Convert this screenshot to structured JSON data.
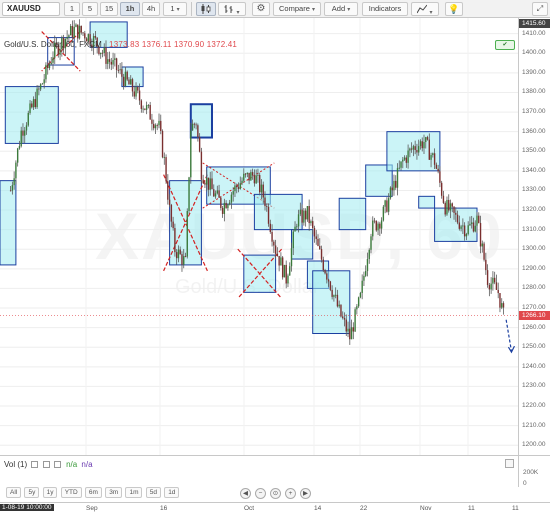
{
  "toolbar": {
    "symbol": "XAUUSD",
    "intervals": [
      "1",
      "5",
      "15",
      "1h",
      "4h",
      "1"
    ],
    "active_interval": "1h",
    "compare_label": "Compare",
    "add_label": "Add",
    "indicators_label": "Indicators"
  },
  "legend": {
    "title": "Gold/U.S. Dollar, 60, FXCM",
    "ohlc": [
      "1373.83",
      "1376.11",
      "1370.90",
      "1372.41"
    ]
  },
  "watermark": {
    "symbol": "XAUUSD, 60",
    "description": "Gold/U.S. Dollar"
  },
  "price_axis": {
    "ticks": [
      "1410.00",
      "1400.00",
      "1390.00",
      "1380.00",
      "1370.00",
      "1360.00",
      "1350.00",
      "1340.00",
      "1330.00",
      "1320.00",
      "1310.00",
      "1300.00",
      "1290.00",
      "1280.00",
      "1270.00",
      "1260.00",
      "1250.00",
      "1240.00",
      "1230.00",
      "1220.00",
      "1210.00",
      "1200.00"
    ],
    "top_badge": "1415.60",
    "last_price": "1266.10"
  },
  "volume": {
    "label": "Vol (1)",
    "value1": "n/a",
    "value2": "n/a",
    "ticks": [
      "200K",
      "0"
    ]
  },
  "range_buttons": [
    "All",
    "5y",
    "1y",
    "YTD",
    "6m",
    "3m",
    "1m",
    "5d",
    "1d"
  ],
  "nav_controls": [
    "◀",
    "−",
    "⊙",
    "+",
    "▶"
  ],
  "time_axis": {
    "crosshair_label": "1-08-19 10:00:00",
    "labels": [
      "Sep",
      "16",
      "Oct",
      "14",
      "22",
      "Nov",
      "11",
      "11"
    ]
  },
  "colors": {
    "accent": "#1976d2",
    "zone_fill": "#c8f4f6",
    "zone_border": "#1b3fa0",
    "down_marker": "#d32020",
    "last_price": "#e0484c"
  },
  "chart_data": {
    "type": "candlestick",
    "symbol": "XAUUSD",
    "interval": "60",
    "ylim": [
      1195,
      1418
    ],
    "price_path": [
      {
        "t": 0,
        "p": 1330
      },
      {
        "t": 2,
        "p": 1360
      },
      {
        "t": 4,
        "p": 1372
      },
      {
        "t": 6,
        "p": 1385
      },
      {
        "t": 8,
        "p": 1400
      },
      {
        "t": 10,
        "p": 1407
      },
      {
        "t": 12,
        "p": 1412
      },
      {
        "t": 14,
        "p": 1410
      },
      {
        "t": 16,
        "p": 1406
      },
      {
        "t": 18,
        "p": 1398
      },
      {
        "t": 20,
        "p": 1392
      },
      {
        "t": 22,
        "p": 1385
      },
      {
        "t": 24,
        "p": 1378
      },
      {
        "t": 26,
        "p": 1370
      },
      {
        "t": 28,
        "p": 1362
      },
      {
        "t": 29,
        "p": 1345
      },
      {
        "t": 30,
        "p": 1320
      },
      {
        "t": 31,
        "p": 1300
      },
      {
        "t": 33,
        "p": 1293
      },
      {
        "t": 34,
        "p": 1362
      },
      {
        "t": 35,
        "p": 1365
      },
      {
        "t": 36,
        "p": 1340
      },
      {
        "t": 38,
        "p": 1330
      },
      {
        "t": 40,
        "p": 1322
      },
      {
        "t": 42,
        "p": 1330
      },
      {
        "t": 44,
        "p": 1336
      },
      {
        "t": 46,
        "p": 1338
      },
      {
        "t": 48,
        "p": 1325
      },
      {
        "t": 50,
        "p": 1300
      },
      {
        "t": 52,
        "p": 1285
      },
      {
        "t": 54,
        "p": 1315
      },
      {
        "t": 56,
        "p": 1318
      },
      {
        "t": 58,
        "p": 1300
      },
      {
        "t": 60,
        "p": 1285
      },
      {
        "t": 62,
        "p": 1268
      },
      {
        "t": 64,
        "p": 1255
      },
      {
        "t": 66,
        "p": 1275
      },
      {
        "t": 68,
        "p": 1310
      },
      {
        "t": 70,
        "p": 1316
      },
      {
        "t": 72,
        "p": 1330
      },
      {
        "t": 74,
        "p": 1345
      },
      {
        "t": 76,
        "p": 1352
      },
      {
        "t": 78,
        "p": 1355
      },
      {
        "t": 80,
        "p": 1345
      },
      {
        "t": 82,
        "p": 1322
      },
      {
        "t": 84,
        "p": 1316
      },
      {
        "t": 86,
        "p": 1310
      },
      {
        "t": 88,
        "p": 1315
      },
      {
        "t": 89,
        "p": 1300
      },
      {
        "t": 90,
        "p": 1285
      },
      {
        "t": 92,
        "p": 1278
      },
      {
        "t": 93,
        "p": 1266.1
      }
    ],
    "zones": [
      {
        "t0": -1,
        "t1": 9,
        "lo": 1354,
        "hi": 1383,
        "style": "fill"
      },
      {
        "t0": -2,
        "t1": 1,
        "lo": 1292,
        "hi": 1335,
        "style": "fill"
      },
      {
        "t0": 7,
        "t1": 12,
        "lo": 1394,
        "hi": 1408,
        "style": "cross"
      },
      {
        "t0": 15,
        "t1": 22,
        "lo": 1403,
        "hi": 1416,
        "style": "fill"
      },
      {
        "t0": 21,
        "t1": 25,
        "lo": 1383,
        "hi": 1393,
        "style": "fill"
      },
      {
        "t0": 30,
        "t1": 36,
        "lo": 1292,
        "hi": 1335,
        "style": "fill-cross"
      },
      {
        "t0": 34,
        "t1": 38,
        "lo": 1357,
        "hi": 1374,
        "style": "fill-thick"
      },
      {
        "t0": 37,
        "t1": 49,
        "lo": 1323,
        "hi": 1342,
        "style": "fill-diag"
      },
      {
        "t0": 46,
        "t1": 55,
        "lo": 1310,
        "hi": 1328,
        "style": "fill"
      },
      {
        "t0": 44,
        "t1": 50,
        "lo": 1278,
        "hi": 1297,
        "style": "fill-cross"
      },
      {
        "t0": 53,
        "t1": 57,
        "lo": 1295,
        "hi": 1310,
        "style": "fill"
      },
      {
        "t0": 56,
        "t1": 60,
        "lo": 1280,
        "hi": 1294,
        "style": "fill"
      },
      {
        "t0": 57,
        "t1": 64,
        "lo": 1257,
        "hi": 1289,
        "style": "fill"
      },
      {
        "t0": 62,
        "t1": 67,
        "lo": 1310,
        "hi": 1326,
        "style": "fill"
      },
      {
        "t0": 67,
        "t1": 72,
        "lo": 1327,
        "hi": 1343,
        "style": "fill"
      },
      {
        "t0": 71,
        "t1": 81,
        "lo": 1340,
        "hi": 1360,
        "style": "fill"
      },
      {
        "t0": 77,
        "t1": 80,
        "lo": 1321,
        "hi": 1327,
        "style": "fill"
      },
      {
        "t0": 80,
        "t1": 88,
        "lo": 1304,
        "hi": 1321,
        "style": "fill"
      }
    ],
    "projection": {
      "t0": 93.5,
      "t1": 94.5,
      "p0": 1264,
      "p1": 1248
    }
  }
}
